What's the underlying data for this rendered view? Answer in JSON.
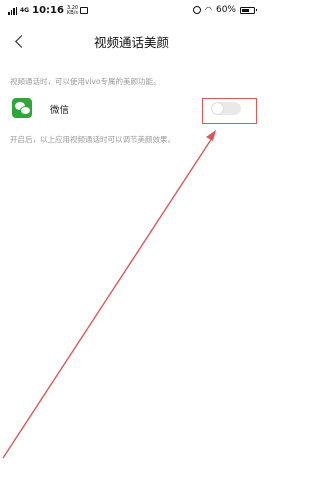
{
  "status_bar": {
    "network": "4G",
    "time": "10:16",
    "speed_value": "3.20",
    "speed_unit": "KB/s",
    "battery": "60%"
  },
  "header": {
    "title": "视频通话美颜"
  },
  "description": "视频通话时，可以使用vivo专属的美颜功能。",
  "apps": [
    {
      "name": "微信",
      "icon": "wechat-icon",
      "enabled": false
    }
  ],
  "hint": "开启后，以上应用视频通话时可以调节美颜效果。",
  "colors": {
    "annotation": "#d9595b",
    "wechat_green": "#2ea639",
    "secondary_text": "#9a9a9a"
  }
}
